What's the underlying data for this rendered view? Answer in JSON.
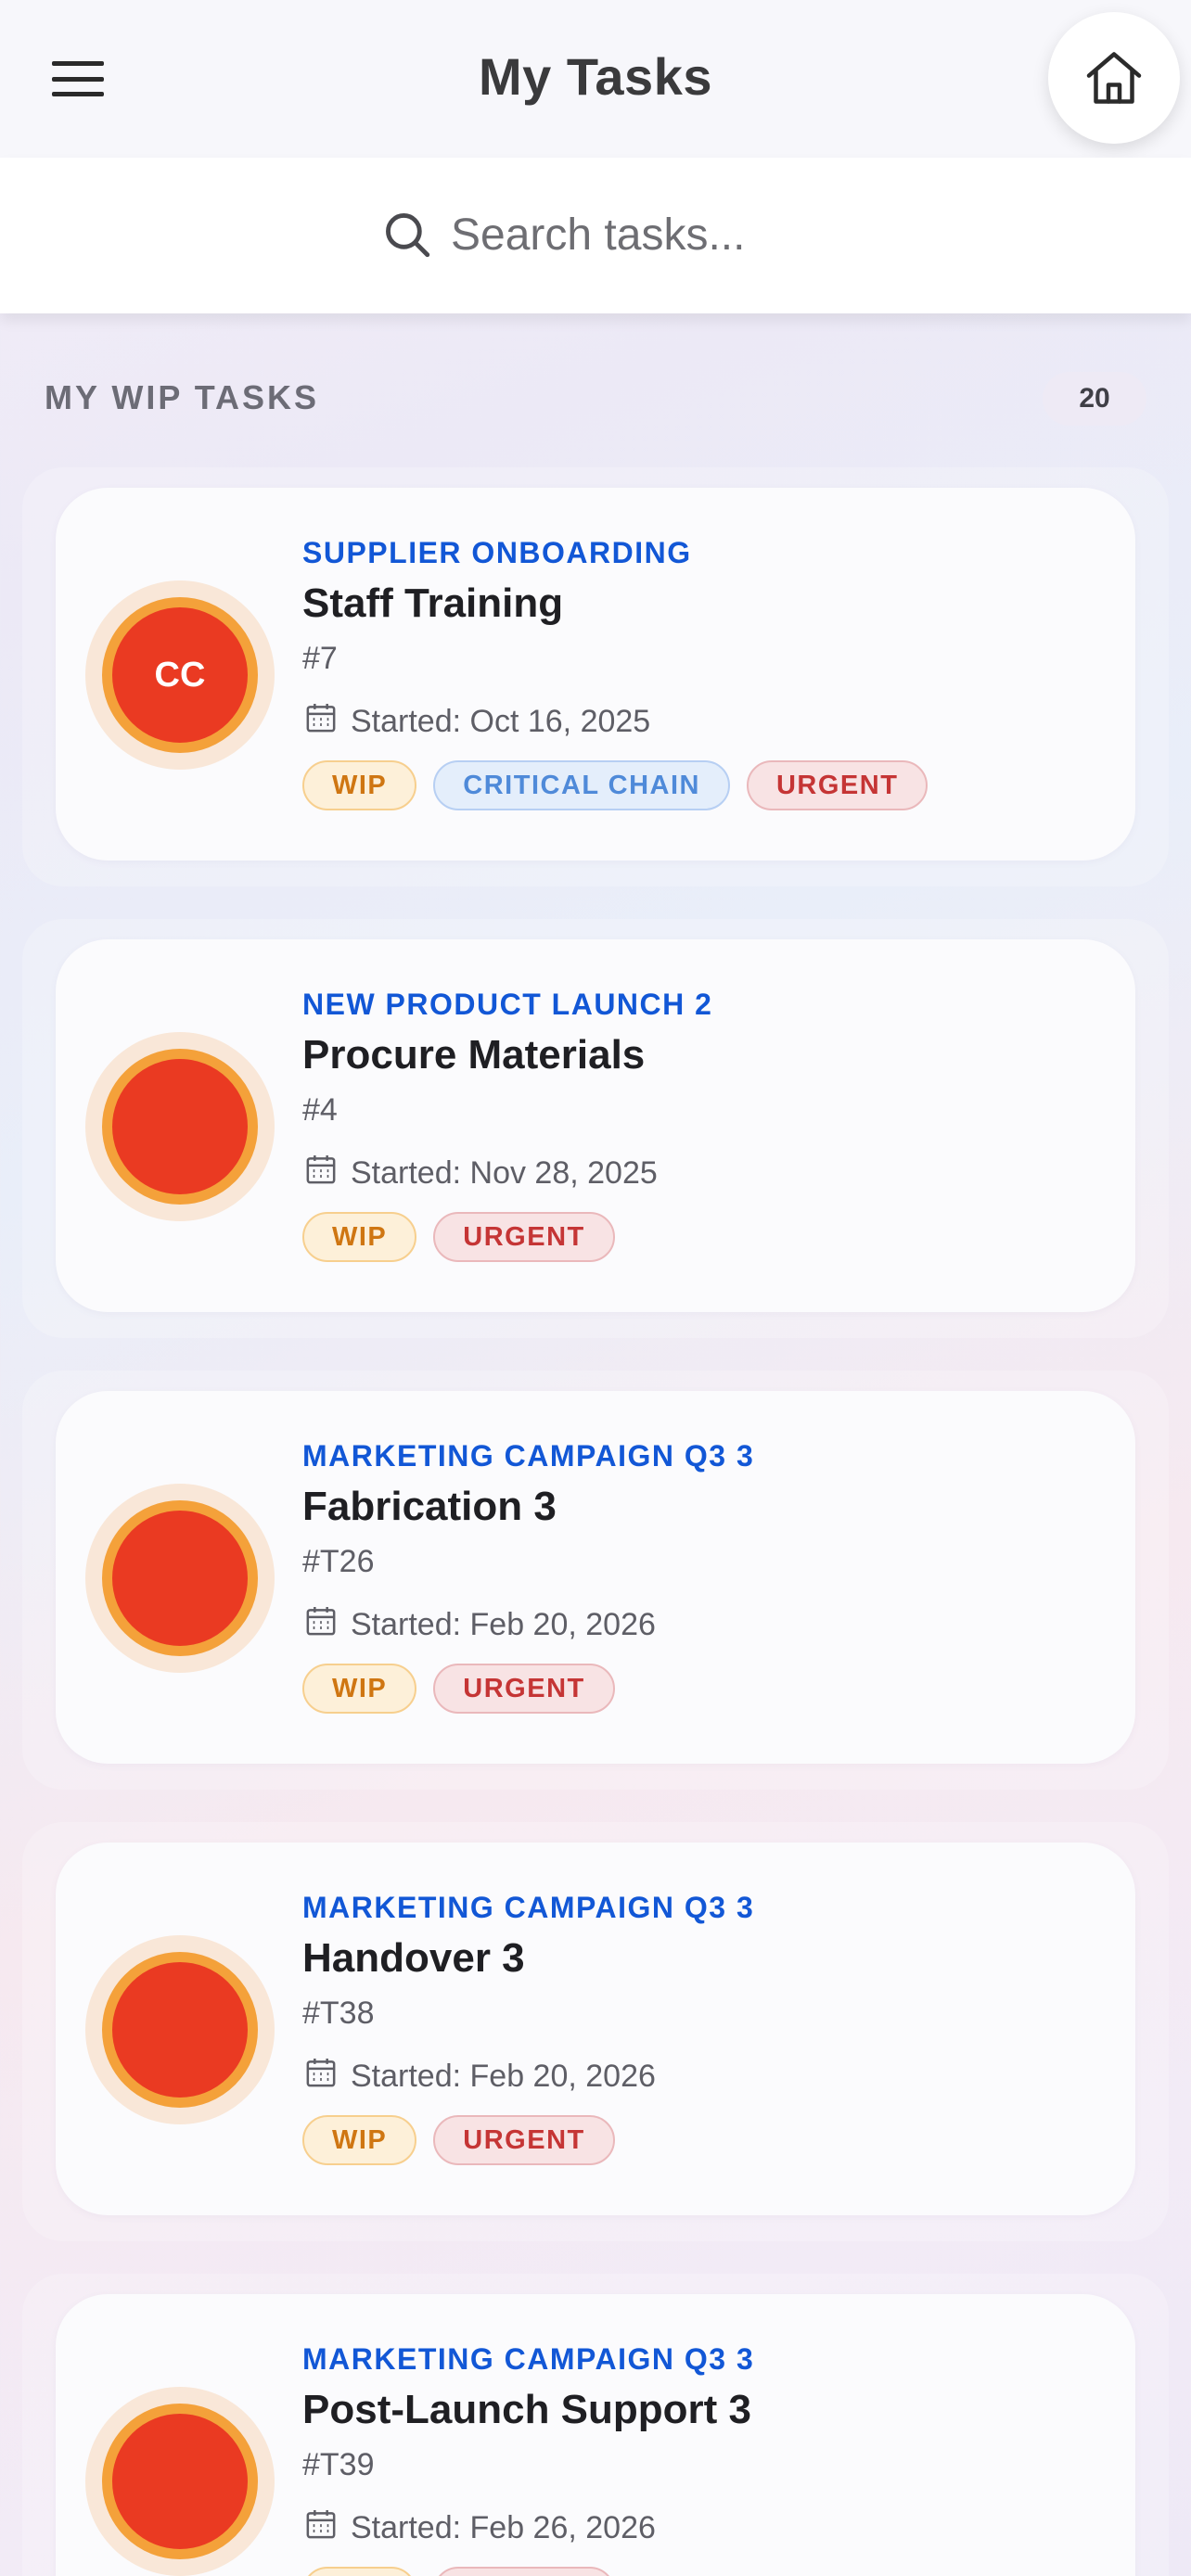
{
  "header": {
    "title": "My Tasks",
    "menu_icon": "hamburger-menu-icon",
    "home_icon": "home-icon"
  },
  "search": {
    "placeholder": "Search tasks...",
    "value": "",
    "icon": "search-icon"
  },
  "section": {
    "title": "MY WIP TASKS",
    "count": "20"
  },
  "colors": {
    "avatar_fill": "#ea3a22",
    "avatar_ring": "#f4a13a",
    "project_label": "#1257d6",
    "wip_tag": "#cf7612",
    "critical_chain_tag": "#4f8ad9",
    "urgent_tag": "#c53535"
  },
  "tasks": [
    {
      "avatar_text": "CC",
      "project": "SUPPLIER ONBOARDING",
      "name": "Staff Training",
      "id": "#7",
      "started": "Started: Oct 16, 2025",
      "tags": [
        "WIP",
        "CRITICAL CHAIN",
        "URGENT"
      ]
    },
    {
      "avatar_text": "",
      "project": "NEW PRODUCT LAUNCH 2",
      "name": "Procure Materials",
      "id": "#4",
      "started": "Started: Nov 28, 2025",
      "tags": [
        "WIP",
        "URGENT"
      ]
    },
    {
      "avatar_text": "",
      "project": "MARKETING CAMPAIGN Q3 3",
      "name": "Fabrication 3",
      "id": "#T26",
      "started": "Started: Feb 20, 2026",
      "tags": [
        "WIP",
        "URGENT"
      ]
    },
    {
      "avatar_text": "",
      "project": "MARKETING CAMPAIGN Q3 3",
      "name": "Handover 3",
      "id": "#T38",
      "started": "Started: Feb 20, 2026",
      "tags": [
        "WIP",
        "URGENT"
      ]
    },
    {
      "avatar_text": "",
      "project": "MARKETING CAMPAIGN Q3 3",
      "name": "Post-Launch Support 3",
      "id": "#T39",
      "started": "Started: Feb 26, 2026",
      "tags": [
        "WIP",
        "URGENT"
      ]
    }
  ]
}
